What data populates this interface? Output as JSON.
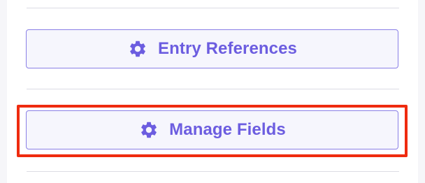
{
  "panel": {
    "buttons": [
      {
        "label": "Entry References",
        "icon": "gear-icon"
      },
      {
        "label": "Manage Fields",
        "icon": "gear-icon"
      }
    ]
  },
  "colors": {
    "accent": "#6c5de0",
    "button_border": "#8a7fe6",
    "button_bg": "#f6f6fd",
    "divider": "#dcdce4",
    "highlight": "#ef2b0f"
  }
}
